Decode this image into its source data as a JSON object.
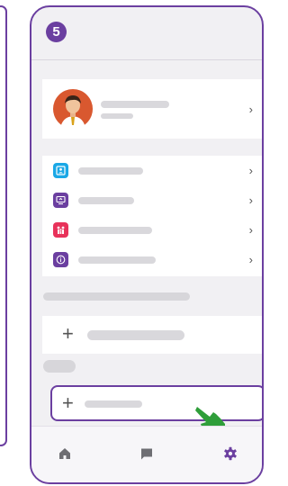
{
  "step": {
    "number": "5"
  },
  "profile": {
    "chevron": "›"
  },
  "menu": {
    "items": [
      {
        "icon": "contact-card-icon",
        "color": "#1aa8e6",
        "chevron": "›"
      },
      {
        "icon": "screen-share-icon",
        "color": "#6b3fa0",
        "chevron": "›"
      },
      {
        "icon": "family-icon",
        "color": "#e8325a",
        "chevron": "›"
      },
      {
        "icon": "info-icon",
        "color": "#6b3fa0",
        "chevron": "›"
      }
    ]
  },
  "add_items": [
    {
      "symbol": "+"
    },
    {
      "symbol": "+"
    }
  ],
  "tabs": [
    {
      "icon": "home-icon"
    },
    {
      "icon": "chat-icon"
    },
    {
      "icon": "settings-icon",
      "active": true
    }
  ],
  "colors": {
    "accent": "#6b3fa0",
    "pointer": "#2f9e3a"
  }
}
